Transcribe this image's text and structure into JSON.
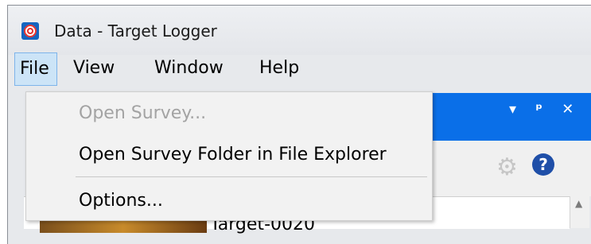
{
  "window": {
    "title": "Data - Target Logger",
    "app_icon": "target-icon"
  },
  "menubar": {
    "items": [
      {
        "label": "File",
        "active": true
      },
      {
        "label": "View",
        "active": false
      },
      {
        "label": "Window",
        "active": false
      },
      {
        "label": "Help",
        "active": false
      }
    ]
  },
  "file_menu": {
    "items": [
      {
        "label": "Open Survey...",
        "enabled": false
      },
      {
        "label": "Open Survey Folder in File Explorer",
        "enabled": true
      },
      {
        "label": "Options...",
        "enabled": true
      }
    ]
  },
  "dock_panel": {
    "pin_icon": "pin-icon",
    "close_icon": "close-icon",
    "dropdown_icon": "chevron-down-icon",
    "accent_color": "#0a6fe8"
  },
  "toolbar": {
    "settings_icon": "gear-icon",
    "help_icon": "help-icon"
  },
  "content": {
    "target_label": "Target-0020"
  }
}
